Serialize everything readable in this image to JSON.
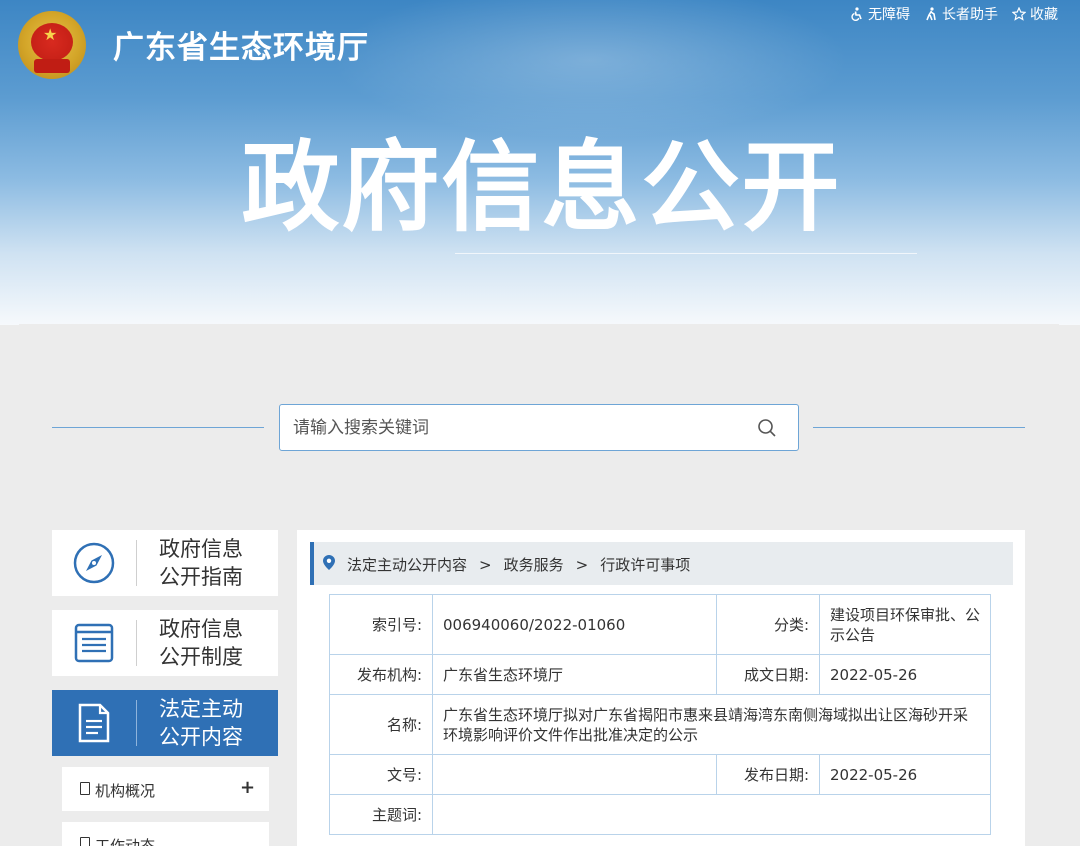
{
  "header": {
    "site_title": "广东省生态环境厅",
    "big_title": "政府信息公开",
    "links": [
      {
        "label": "无障碍",
        "icon": "accessibility-icon"
      },
      {
        "label": "长者助手",
        "icon": "elderly-icon"
      },
      {
        "label": "收藏",
        "icon": "star-icon"
      }
    ]
  },
  "search": {
    "placeholder": "请输入搜索关键词"
  },
  "sidebar": {
    "cards": [
      {
        "line1": "政府信息",
        "line2": "公开指南",
        "icon": "compass-icon",
        "active": false
      },
      {
        "line1": "政府信息",
        "line2": "公开制度",
        "icon": "list-icon",
        "active": false
      },
      {
        "line1": "法定主动",
        "line2": "公开内容",
        "icon": "document-icon",
        "active": true
      }
    ],
    "sub_items": [
      {
        "label": "机构概况",
        "expand": "+"
      },
      {
        "label": "工作动态"
      }
    ]
  },
  "breadcrumb": [
    "法定主动公开内容",
    "政务服务",
    "行政许可事项"
  ],
  "info": {
    "index_no_label": "索引号:",
    "index_no": "006940060/2022-01060",
    "category_label": "分类:",
    "category": "建设项目环保审批、公示公告",
    "publisher_label": "发布机构:",
    "publisher": "广东省生态环境厅",
    "created_label": "成文日期:",
    "created": "2022-05-26",
    "name_label": "名称:",
    "name": "广东省生态环境厅拟对广东省揭阳市惠来县靖海湾东南侧海域拟出让区海砂开采环境影响评价文件作出批准决定的公示",
    "doc_no_label": "文号:",
    "doc_no": "",
    "published_label": "发布日期:",
    "published": "2022-05-26",
    "subject_label": "主题词:",
    "subject": ""
  },
  "colors": {
    "primary_blue": "#2f70b5",
    "border_blue": "#b9d3ea",
    "header_top": "#3d86c4"
  }
}
